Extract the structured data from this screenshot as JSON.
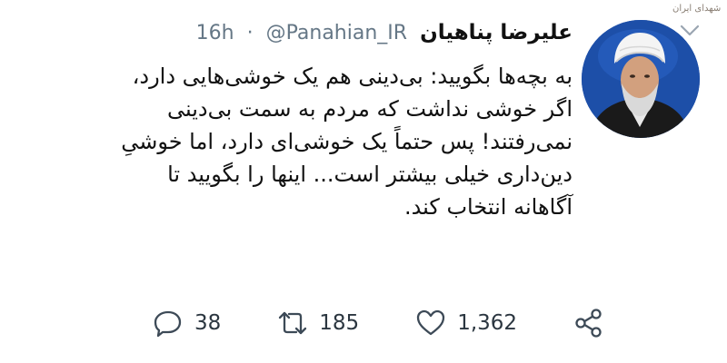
{
  "header": {
    "display_name": "علیرضا پناهیان",
    "handle": "@Panahian_IR",
    "separator": "·",
    "timestamp": "16h"
  },
  "watermark": "شهدای ایران",
  "tweet": {
    "lines": [
      "به بچه‌ها بگویید: بی‌دینی هم یک خوشی‌هایی دارد،",
      "اگر خوشی نداشت که مردم به سمت بی‌دینی",
      "نمی‌رفتند! پس حتماً یک خوشی‌ای دارد، اما خوشیِ",
      "دین‌داری خیلی بیشتر است... اینها را بگویید تا",
      "آگاهانه انتخاب کند."
    ]
  },
  "actions": {
    "reply_count": "38",
    "retweet_count": "185",
    "like_count": "1,362"
  },
  "icons": {
    "reply": "reply-icon",
    "retweet": "retweet-icon",
    "like": "heart-icon",
    "share": "share-icon",
    "menu": "chevron-down-icon"
  },
  "colors": {
    "icon_gray": "#3d4a57",
    "handle_gray": "#657786",
    "avatar_bg": "#1d4fa8"
  }
}
